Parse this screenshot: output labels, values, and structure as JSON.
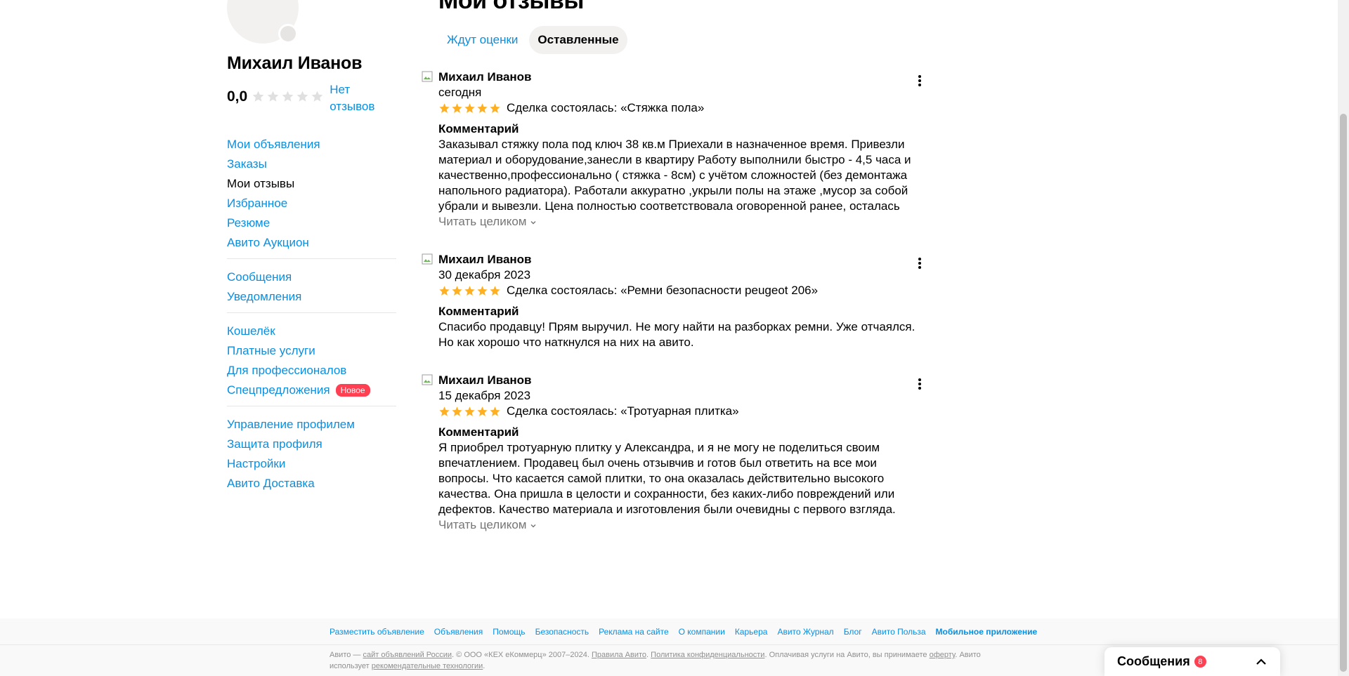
{
  "profile": {
    "name": "Михаил Иванов",
    "rating": "0,0",
    "rating_link": "Нет отзывов"
  },
  "nav": {
    "group1": [
      "Мои объявления",
      "Заказы",
      "Мои отзывы",
      "Избранное",
      "Резюме",
      "Авито Аукцион"
    ],
    "group2": [
      "Сообщения",
      "Уведомления"
    ],
    "group3": [
      "Кошелёк",
      "Платные услуги",
      "Для профессионалов",
      "Спецпредложения"
    ],
    "group3_badge": "Новое",
    "group4": [
      "Управление профилем",
      "Защита профиля",
      "Настройки",
      "Авито Доставка"
    ]
  },
  "main": {
    "heading": "Мои отзывы",
    "tabs": [
      "Ждут оценки",
      "Оставленные"
    ]
  },
  "reviews": [
    {
      "author": "Михаил Иванов",
      "date": "сегодня",
      "deal": "Сделка состоялась: «Стяжка пола»",
      "comment_title": "Комментарий",
      "comment": "Заказывал стяжку пола под ключ 38 кв.м Приехали в назначенное время. Привезли материал и оборудование,занесли в квартиру Работу выполнили быстро - 4,5 часа и качественно,профессионально ( стяжка - 8см) с учётом сложностей (без демонтажа напольного радиатора). Работали аккуратно ,укрыли полы на этаже ,мусор за собой убрали и вывезли. Цена полностью соответствовала оговоренной ранее, осталась без…",
      "read_more": "Читать целиком"
    },
    {
      "author": "Михаил Иванов",
      "date": "30 декабря 2023",
      "deal": "Сделка состоялась: «Ремни безопасности peugeot 206»",
      "comment_title": "Комментарий",
      "comment": "Спасибо продавцу! Прям выручил. Не могу найти на разборках ремни. Уже отчаялся. Но как хорошо что наткнулся на них на авито."
    },
    {
      "author": "Михаил Иванов",
      "date": "15 декабря 2023",
      "deal": "Сделка состоялась: «Тротуарная плитка»",
      "comment_title": "Комментарий",
      "comment": "Я приобрел тротуарную плитку у Александра, и я не могу не поделиться своим впечатлением. Продавец был очень отзывчив и готов был ответить на все мои вопросы. Что касается самой плитки, то она оказалась действительно высокого качества. Она пришла в целости и сохранности, без каких-либо повреждений или дефектов. Качество материала и изготовления были очевидны с первого взгляда. Плитка была легко…",
      "read_more": "Читать целиком"
    }
  ],
  "footer": {
    "links": [
      "Разместить объявление",
      "Объявления",
      "Помощь",
      "Безопасность",
      "Реклама на сайте",
      "О компании",
      "Карьера",
      "Авито Журнал",
      "Блог",
      "Авито Польза",
      "Мобильное приложение"
    ],
    "legal_prefix": "Авито — ",
    "legal_link1": "сайт объявлений России",
    "legal_mid1": ". © ООО «КЕХ еКоммерц» 2007–2024. ",
    "legal_link2": "Правила Авито",
    "legal_mid2": ". ",
    "legal_link3": "Политика конфиденциальности",
    "legal_mid3": ". Оплачивая услуги на Авито, вы принимаете ",
    "legal_link4": "оферту",
    "legal_mid4": ". Авито использует ",
    "legal_link5": "рекомендательные технологии",
    "legal_end": "."
  },
  "messenger": {
    "title": "Сообщения",
    "count": "8"
  },
  "colors": {
    "link": "#0a8ee0",
    "star": "#ffb021",
    "badge": "#ff4053"
  }
}
